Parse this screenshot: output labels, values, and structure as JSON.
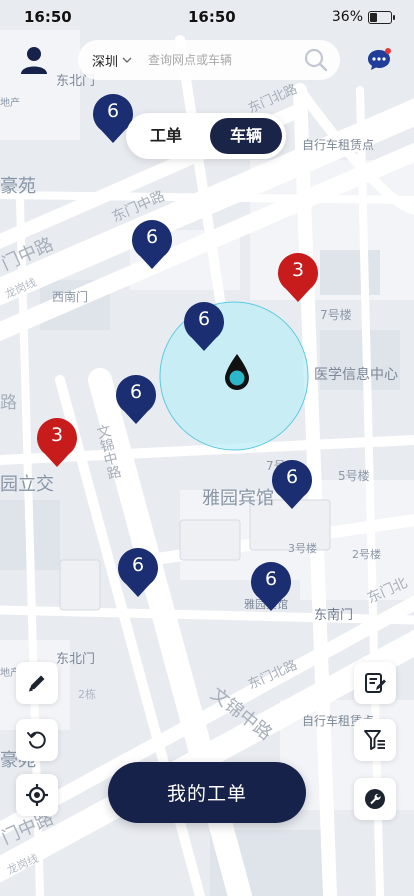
{
  "status_bar": {
    "time_left": "16:50",
    "time_center": "16:50",
    "battery": "36%",
    "battery_level": 0.36
  },
  "search": {
    "city": "深圳",
    "placeholder": "查询网点或车辆"
  },
  "toggle": {
    "tab_orders": "工单",
    "tab_vehicles": "车辆",
    "active": "车辆"
  },
  "map": {
    "labels": [
      {
        "text": "东北门"
      },
      {
        "text": "地产"
      },
      {
        "text": "东门北路"
      },
      {
        "text": "自行车租赁点"
      },
      {
        "text": "豪苑"
      },
      {
        "text": "东门中路"
      },
      {
        "text": "门中路"
      },
      {
        "text": "西南门"
      },
      {
        "text": "龙岗线"
      },
      {
        "text": "7号楼"
      },
      {
        "text": "医学信息中心"
      },
      {
        "text": "文锦中路"
      },
      {
        "text": "园立交"
      },
      {
        "text": "7号"
      },
      {
        "text": "5号楼"
      },
      {
        "text": "雅园宾馆"
      },
      {
        "text": "3号楼"
      },
      {
        "text": "2号楼"
      },
      {
        "text": "雅园宾馆"
      },
      {
        "text": "东南门"
      },
      {
        "text": "东门北"
      },
      {
        "text": "东北门"
      },
      {
        "text": "地产"
      },
      {
        "text": "2栋"
      },
      {
        "text": "东门北路"
      },
      {
        "text": "自行车租赁点"
      },
      {
        "text": "文锦中路"
      },
      {
        "text": "豪苑"
      },
      {
        "text": "门中路"
      },
      {
        "text": "龙岗线"
      },
      {
        "text": "路"
      }
    ],
    "markers": [
      {
        "count": "6",
        "color": "#1c2e72"
      },
      {
        "count": "6",
        "color": "#1c2e72"
      },
      {
        "count": "3",
        "color": "#c81b1b"
      },
      {
        "count": "6",
        "color": "#1c2e72"
      },
      {
        "count": "6",
        "color": "#1c2e72"
      },
      {
        "count": "3",
        "color": "#c81b1b"
      },
      {
        "count": "6",
        "color": "#1c2e72"
      },
      {
        "count": "6",
        "color": "#1c2e72"
      },
      {
        "count": "6",
        "color": "#1c2e72"
      }
    ]
  },
  "buttons": {
    "main": "我的工单",
    "left_icons": [
      "edit-icon",
      "refresh-icon",
      "locate-icon"
    ],
    "right_icons": [
      "notes-icon",
      "filter-icon",
      "wrench-icon"
    ]
  },
  "colors": {
    "navy": "#17224a",
    "marker_blue": "#1c2e72",
    "marker_red": "#c81b1b",
    "range_fill": "#bdeef7",
    "range_stroke": "#5ccbe0",
    "message_badge": "#e53935"
  }
}
